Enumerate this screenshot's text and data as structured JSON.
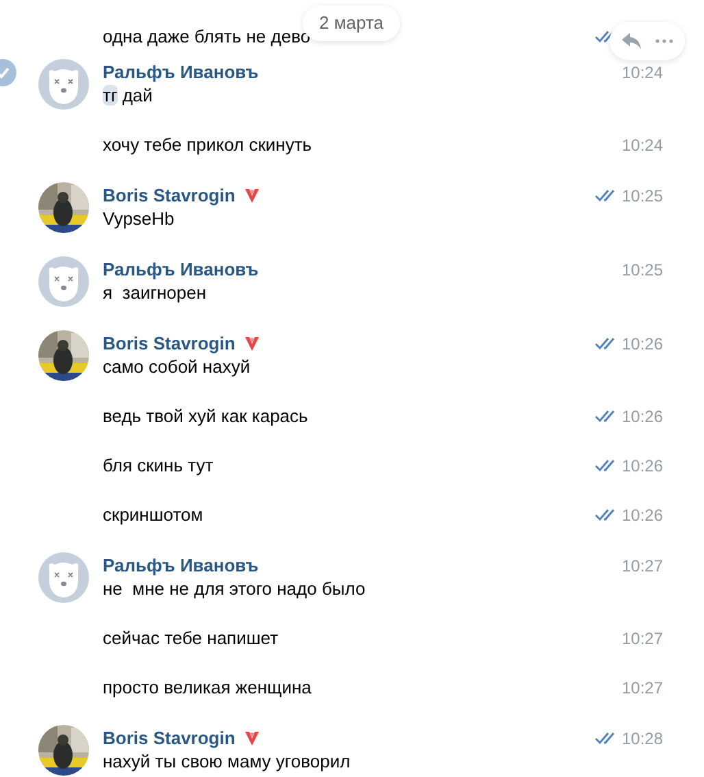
{
  "date_pill": "2 марта",
  "messages": [
    {
      "kind": "continuation",
      "selected": false,
      "read": true,
      "text": "одна даже блять не дево"
    },
    {
      "kind": "group",
      "selected": true,
      "photo_avatar": false,
      "name": "Ральфъ Ивановъ",
      "badge": false,
      "time": "10:24",
      "read": false,
      "text_parts": [
        {
          "text": "тг",
          "highlighted": true
        },
        {
          "text": " дай",
          "highlighted": false
        }
      ]
    },
    {
      "kind": "continuation",
      "selected": false,
      "read": false,
      "text": "хочу тебе прикол скинуть",
      "time": "10:24"
    },
    {
      "kind": "group",
      "selected": false,
      "photo_avatar": true,
      "name": "Boris Stavrogin",
      "badge": true,
      "time": "10:25",
      "read": true,
      "text": "VypseHb"
    },
    {
      "kind": "group",
      "selected": false,
      "photo_avatar": false,
      "name": "Ральфъ Ивановъ",
      "badge": false,
      "time": "10:25",
      "read": false,
      "text": "я  заигнорен"
    },
    {
      "kind": "group",
      "selected": false,
      "photo_avatar": true,
      "name": "Boris Stavrogin",
      "badge": true,
      "time": "10:26",
      "read": true,
      "text": "само собой нахуй"
    },
    {
      "kind": "continuation",
      "selected": false,
      "read": true,
      "text": "ведь твой хуй как карась",
      "time": "10:26"
    },
    {
      "kind": "continuation",
      "selected": false,
      "read": true,
      "text": "бля скинь тут",
      "time": "10:26"
    },
    {
      "kind": "continuation",
      "selected": false,
      "read": true,
      "text": "скриншотом",
      "time": "10:26"
    },
    {
      "kind": "group",
      "selected": false,
      "photo_avatar": false,
      "name": "Ральфъ Ивановъ",
      "badge": false,
      "time": "10:27",
      "read": false,
      "text": "не  мне не для этого надо было"
    },
    {
      "kind": "continuation",
      "selected": false,
      "read": false,
      "text": "сейчас тебе напишет",
      "time": "10:27"
    },
    {
      "kind": "continuation",
      "selected": false,
      "read": false,
      "text": "просто великая женщина",
      "time": "10:27"
    },
    {
      "kind": "group",
      "selected": false,
      "photo_avatar": true,
      "name": "Boris Stavrogin",
      "badge": true,
      "time": "10:28",
      "read": true,
      "text": "нахуй ты свою маму уговорил"
    }
  ]
}
